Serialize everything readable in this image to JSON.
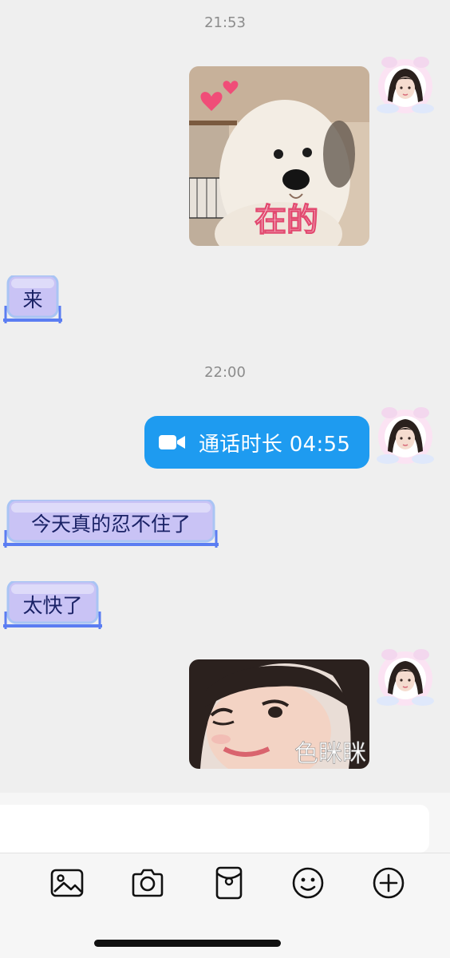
{
  "chat": {
    "timestamps": [
      "21:53",
      "22:00"
    ],
    "call": {
      "text": "通话时长 04:55",
      "icon": "video-camera-icon"
    },
    "received": [
      "来",
      "今天真的忍不住了",
      "太快了"
    ],
    "stickers": {
      "dog_caption": "在的",
      "girl_caption": "色眯眯"
    }
  },
  "toolbar": {
    "icons": [
      "image-icon",
      "camera-icon",
      "red-packet-icon",
      "emoji-icon",
      "plus-circle-icon"
    ]
  },
  "colors": {
    "background": "#efefef",
    "call_bubble": "#1e9bf0",
    "received_frame": "#5b7df2",
    "received_fill": "#c9c3f5"
  }
}
